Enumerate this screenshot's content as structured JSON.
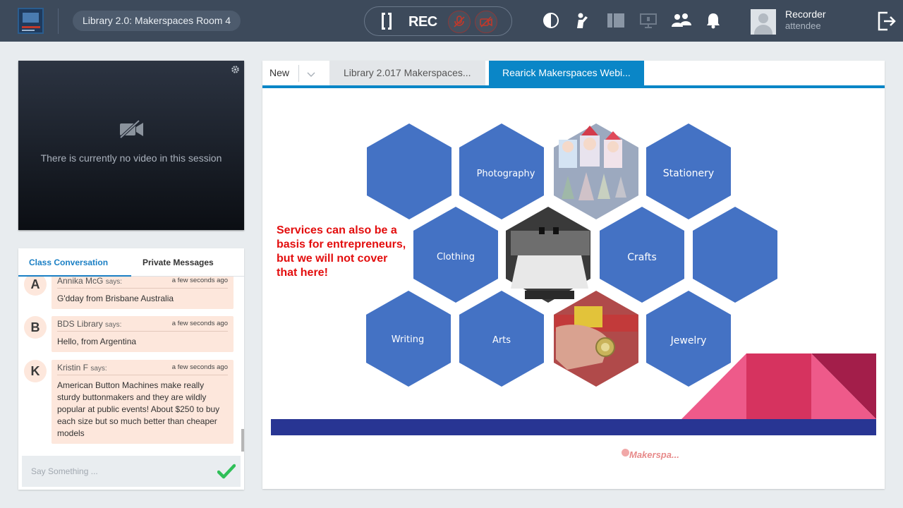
{
  "header": {
    "session_title": "Library 2.0: Makerspaces Room 4",
    "rec_label": "REC",
    "user": {
      "name": "Recorder",
      "role": "attendee"
    }
  },
  "icons": [
    "logo",
    "record-icon",
    "mic-off-icon",
    "camera-off-icon",
    "contrast-icon",
    "raise-hand-icon",
    "layout-icon",
    "screen-share-icon",
    "participants-icon",
    "notification-bell-icon",
    "logout-icon",
    "gear-icon",
    "check-icon",
    "chevron-down-icon"
  ],
  "video": {
    "empty_text": "There is currently no video in this session"
  },
  "chat": {
    "tabs": [
      "Class Conversation",
      "Private Messages"
    ],
    "messages": [
      {
        "initial": "A",
        "name": "Annika McG",
        "says": "says:",
        "time": "a few seconds ago",
        "text": "G'dday from Brisbane Australia"
      },
      {
        "initial": "B",
        "name": "BDS Library",
        "says": "says:",
        "time": "a few seconds ago",
        "text": "Hello, from Argentina"
      },
      {
        "initial": "K",
        "name": "Kristin F",
        "says": "says:",
        "time": "a few seconds ago",
        "text": "American Button Machines make really sturdy buttonmakers and they are wildly popular at public events! About $250 to buy each size but so much better than cheaper models"
      }
    ],
    "input_placeholder": "Say Something ..."
  },
  "presentation": {
    "new_tab_label": "New",
    "tabs": [
      "Library 2.017 Makerspaces...",
      "Rearick Makerspaces Webi..."
    ],
    "slide": {
      "note_lines": [
        "Services can also be a",
        "basis for entrepreneurs,",
        "but we will not cover",
        "that here!"
      ],
      "hexagons": [
        "Photography",
        "Stationery",
        "Clothing",
        "Crafts",
        "Writing",
        "Arts",
        "Jewelry"
      ],
      "footer": "Makerspa...",
      "hex_color": "#4472c4",
      "band_color": "#283593"
    }
  }
}
